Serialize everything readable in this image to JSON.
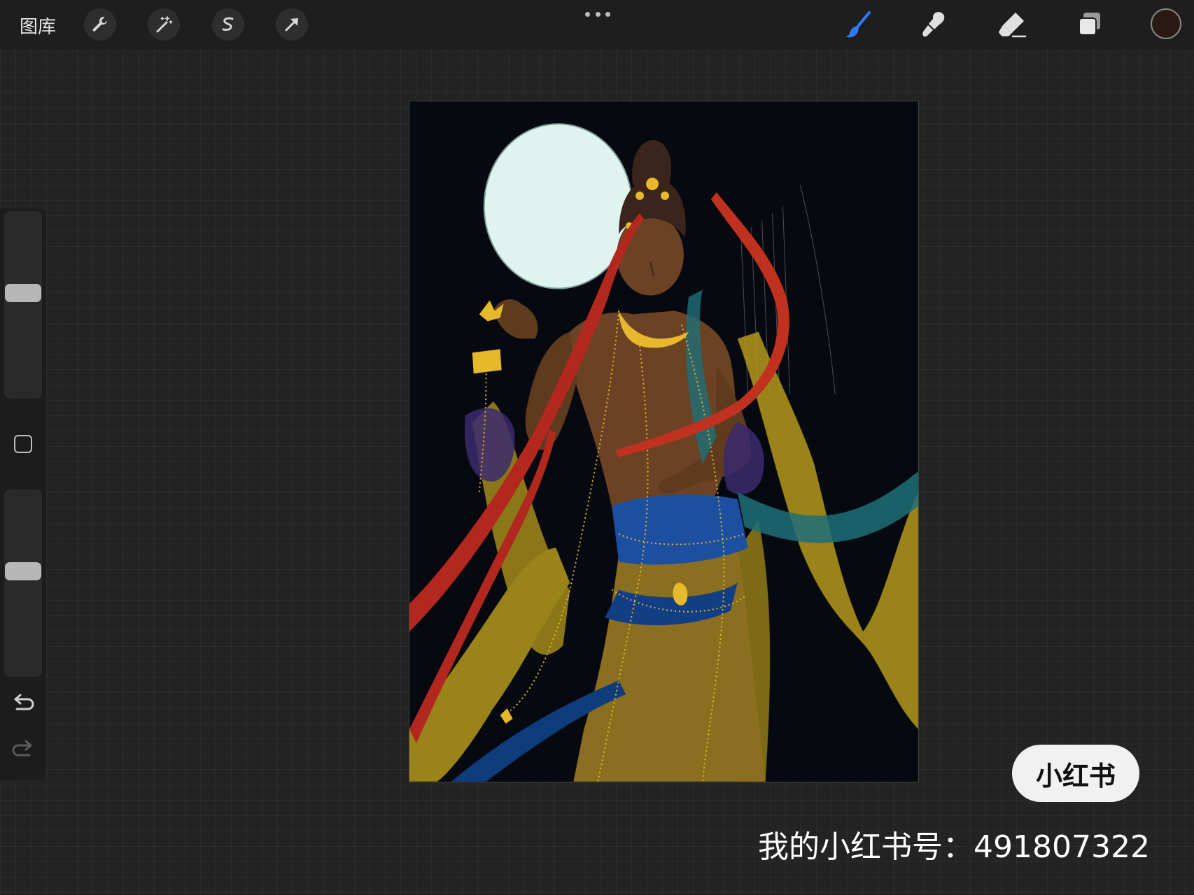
{
  "toolbar": {
    "gallery_label": "图库",
    "left_tools": [
      "wrench-icon",
      "magic-wand-icon",
      "selection-icon",
      "transform-arrow-icon"
    ],
    "right_tools": [
      "brush-icon",
      "smudge-icon",
      "eraser-icon",
      "layers-icon"
    ],
    "active_tool": "brush-icon",
    "accent_color": "#2f7cf6",
    "current_color": "#2b1a14"
  },
  "sidebar": {
    "brush_size_level": 0.57,
    "opacity_level": 0.57,
    "tools": [
      "modify-square-icon",
      "undo-icon",
      "redo-icon"
    ]
  },
  "canvas": {
    "content": "illustration-figure-artwork"
  },
  "watermark": {
    "badge_text": "小红书",
    "account_text": "我的小红书号：491807322"
  }
}
